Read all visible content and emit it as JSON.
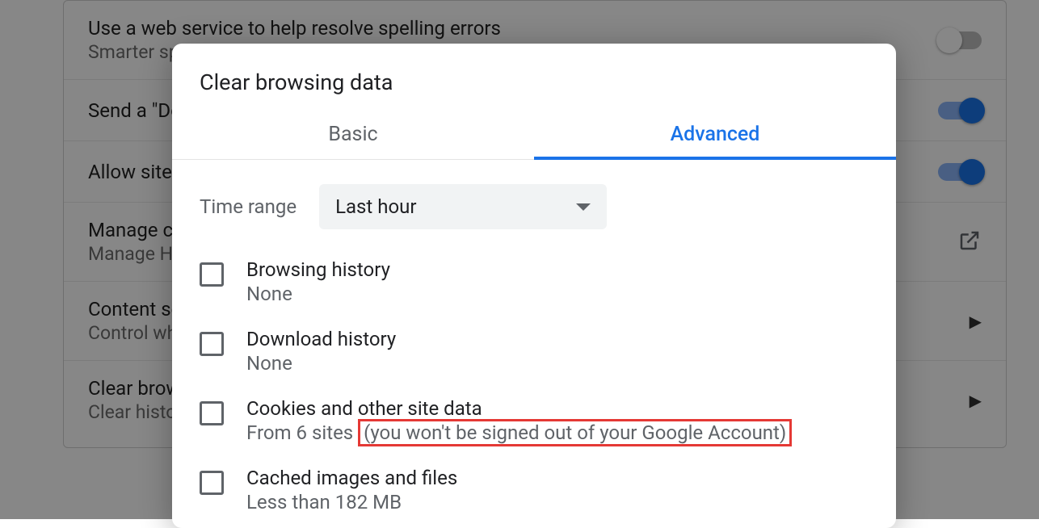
{
  "background": {
    "rows": [
      {
        "title": "Use a web service to help resolve spelling errors",
        "subtitle": "Smarter sp",
        "control": "toggle-off"
      },
      {
        "title": "Send a \"Do",
        "subtitle": "",
        "control": "toggle-on"
      },
      {
        "title": "Allow sites",
        "subtitle": "",
        "control": "toggle-on"
      },
      {
        "title": "Manage ce",
        "subtitle": "Manage HT",
        "control": "external"
      },
      {
        "title": "Content se",
        "subtitle": "Control wha",
        "control": "chevron"
      },
      {
        "title": "Clear brows",
        "subtitle": "Clear histor",
        "control": "chevron"
      }
    ]
  },
  "dialog": {
    "title": "Clear browsing data",
    "tabs": {
      "basic": "Basic",
      "advanced": "Advanced",
      "selected": "advanced"
    },
    "time_range_label": "Time range",
    "time_range_value": "Last hour",
    "options": [
      {
        "title": "Browsing history",
        "sub": "None",
        "highlighted_sub": ""
      },
      {
        "title": "Download history",
        "sub": "None",
        "highlighted_sub": ""
      },
      {
        "title": "Cookies and other site data",
        "sub": "From 6 sites ",
        "highlighted_sub": "(you won't be signed out of your Google Account)"
      },
      {
        "title": "Cached images and files",
        "sub": "Less than 182 MB",
        "highlighted_sub": ""
      }
    ]
  }
}
